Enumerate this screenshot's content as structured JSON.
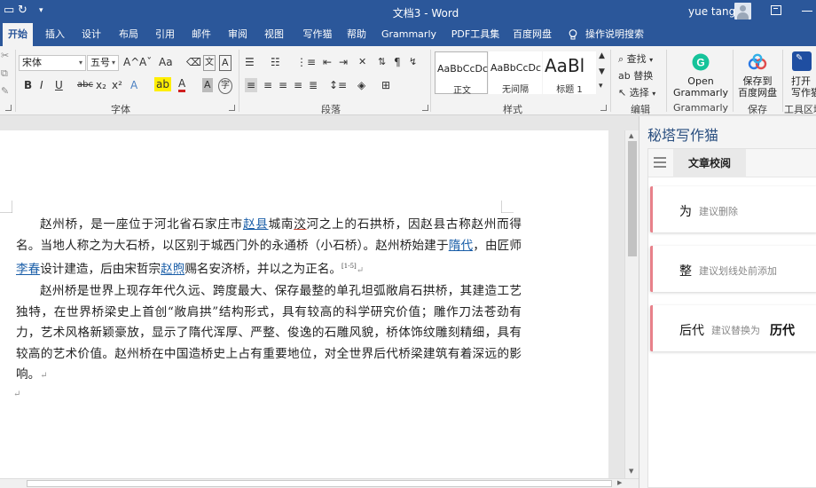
{
  "titlebar": {
    "document_title": "文档3 - Word",
    "user_name": "yue tang"
  },
  "tabs": [
    {
      "label": "开始",
      "active": true
    },
    {
      "label": "插入"
    },
    {
      "label": "设计"
    },
    {
      "label": "布局"
    },
    {
      "label": "引用"
    },
    {
      "label": "邮件"
    },
    {
      "label": "审阅"
    },
    {
      "label": "视图"
    },
    {
      "label": "写作猫"
    },
    {
      "label": "帮助"
    },
    {
      "label": "Grammarly"
    },
    {
      "label": "PDF工具集"
    },
    {
      "label": "百度网盘"
    }
  ],
  "tell_me": "操作说明搜索",
  "ribbon": {
    "font_name": "宋体",
    "font_size": "五号",
    "group_font": "字体",
    "group_paragraph": "段落",
    "group_styles": "样式",
    "group_editing": "编辑",
    "group_grammarly": "Grammarly",
    "group_save": "保存",
    "group_tools": "工具区域",
    "styles": [
      {
        "sample": "AaBbCcDc",
        "name": "正文"
      },
      {
        "sample": "AaBbCcDc",
        "name": "无间隔"
      },
      {
        "sample": "AaBl",
        "name": "标题 1"
      }
    ],
    "editing": {
      "find": "查找",
      "replace": "替换",
      "select": "选择"
    },
    "grammarly_btn": {
      "line1": "Open",
      "line2": "Grammarly"
    },
    "save_btn": {
      "line1": "保存到",
      "line2": "百度网盘"
    },
    "open_btn": {
      "line1": "打开",
      "line2": "写作猫"
    },
    "fmt": {
      "bold": "B",
      "italic": "I",
      "underline": "U",
      "strike": "abc",
      "sub": "x₂",
      "sup": "x²",
      "font_color": "A",
      "grow": "A^",
      "shrink": "Aˇ",
      "case": "Aa",
      "pinyin": "文",
      "border_char": "A",
      "shade_char": "A"
    }
  },
  "document": {
    "paragraph1": {
      "t1": "赵州桥，是一座位于河北省石家庄市",
      "l1": "赵县",
      "t2": "城南",
      "u1": "洨",
      "t3": "河之上的石拱桥，因赵县古称赵州而得名。当地人称之为大石桥，以区别于城西门外的永通桥（小石桥）。赵州桥始建于",
      "l2": "隋代",
      "t4": "，由匠师",
      "l3": "李春",
      "t5": "设计建造，后由宋哲宗",
      "l4": "赵煦",
      "t6": "赐名安济桥，并以之为正名。",
      "ref": "[1-5]"
    },
    "paragraph2": "赵州桥是世界上现存年代久远、跨度最大、保存最整的单孔坦弧敞肩石拱桥，其建造工艺独特，在世界桥梁史上首创“敞肩拱”结构形式，具有较高的科学研究价值；雕作刀法苍劲有力，艺术风格新颖豪放，显示了隋代浑厚、严整、俊逸的石雕风貌，桥体饰纹雕刻精细，具有较高的艺术价值。赵州桥在中国造桥史上占有重要地位，对全世界后代桥梁建筑有着深远的影响。"
  },
  "pane": {
    "title": "秘塔写作猫",
    "tab": "文章校阅",
    "cards": [
      {
        "word": "为",
        "hint": "建议删除",
        "replacement": ""
      },
      {
        "word": "整",
        "hint": "建议划线处前添加",
        "replacement": ""
      },
      {
        "word": "后代",
        "hint": "建议替换为",
        "replacement": "历代"
      }
    ]
  }
}
